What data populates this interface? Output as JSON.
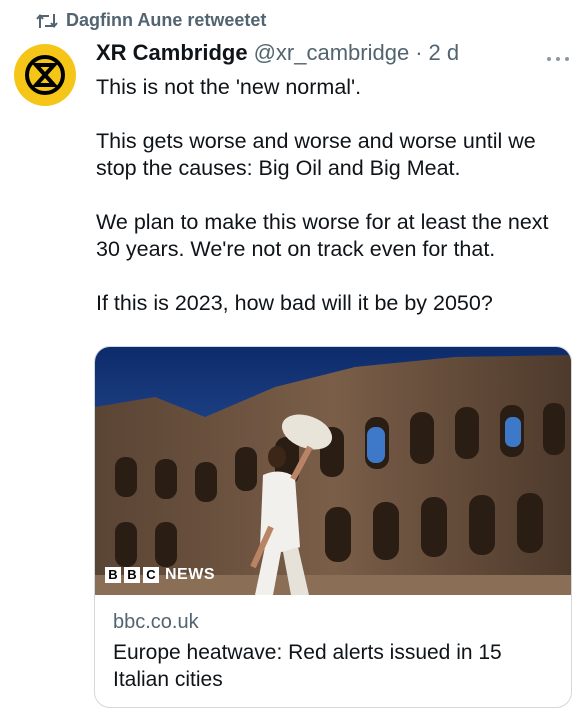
{
  "retweet": {
    "label": "Dagfinn Aune retweetet",
    "icon": "retweet-icon"
  },
  "tweet": {
    "avatar_icon": "extinction-rebellion-logo",
    "name": "XR Cambridge",
    "handle": "@xr_cambridge",
    "separator": "·",
    "time": "2 d",
    "more_icon": "more-options-icon",
    "lines": [
      "This is not the 'new normal'.",
      "This gets worse and worse and worse until we stop the causes: Big Oil and Big Meat.",
      "We plan to make this worse for at least the next 30 years. We're not on track even for that.",
      "If this is 2023, how bad will it be by 2050?"
    ]
  },
  "card": {
    "image_subject": "woman fanning herself in front of the Colosseum",
    "brand": {
      "b1": "B",
      "b2": "B",
      "b3": "C",
      "news": "NEWS"
    },
    "domain": "bbc.co.uk",
    "title": "Europe heatwave: Red alerts issued in 15 Italian cities"
  },
  "colors": {
    "accent_yellow": "#f5c518",
    "secondary_text": "#536471",
    "border": "#cfd9de"
  }
}
